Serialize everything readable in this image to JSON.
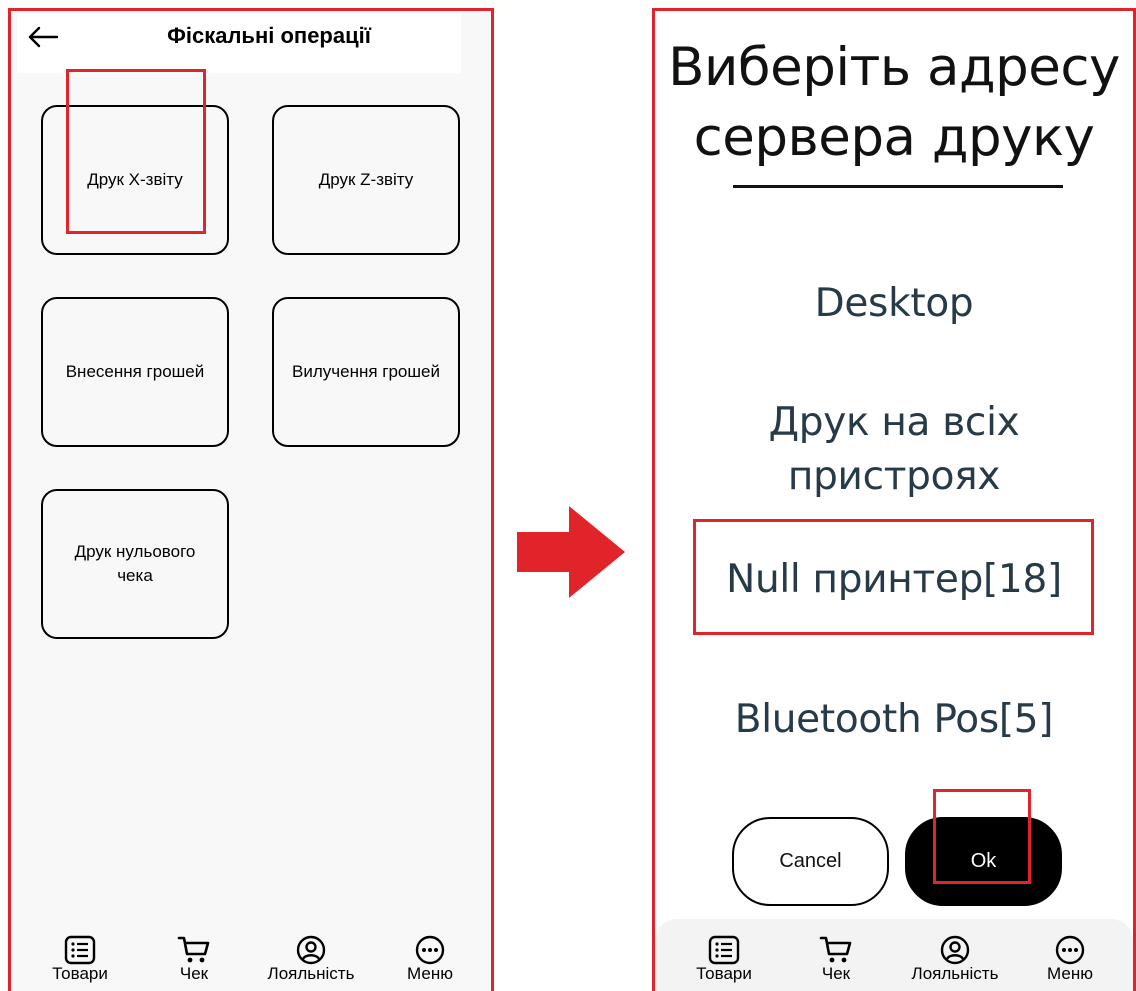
{
  "left_screen": {
    "header": {
      "title": "Фіскальні операції"
    },
    "tiles": [
      {
        "label": "Друк X-звіту"
      },
      {
        "label": "Друк Z-звіту"
      },
      {
        "label": "Внесення грошей"
      },
      {
        "label": "Вилучення грошей"
      },
      {
        "label_line1": "Друк нульового",
        "label_line2": "чека"
      }
    ]
  },
  "right_screen": {
    "dialog": {
      "title_line1": "Виберіть адресу",
      "title_line2": "сервера друку",
      "options": [
        {
          "line1": "Desktop"
        },
        {
          "line1": "Друк на всіх",
          "line2": "пристроях"
        },
        {
          "line1": "Null принтер[18]"
        },
        {
          "line1": "Bluetooth Pos[5]"
        }
      ],
      "cancel_label": "Cancel",
      "ok_label": "Ok"
    }
  },
  "tabbar": {
    "items": [
      {
        "label": "Товари",
        "icon": "list-icon"
      },
      {
        "label": "Чек",
        "icon": "cart-icon"
      },
      {
        "label": "Лояльність",
        "icon": "user-circle-icon"
      },
      {
        "label": "Меню",
        "icon": "more-dots-icon"
      }
    ]
  },
  "colors": {
    "highlight": "#e0242a",
    "option_text": "#263a47",
    "ok_button_bg": "#000000"
  }
}
